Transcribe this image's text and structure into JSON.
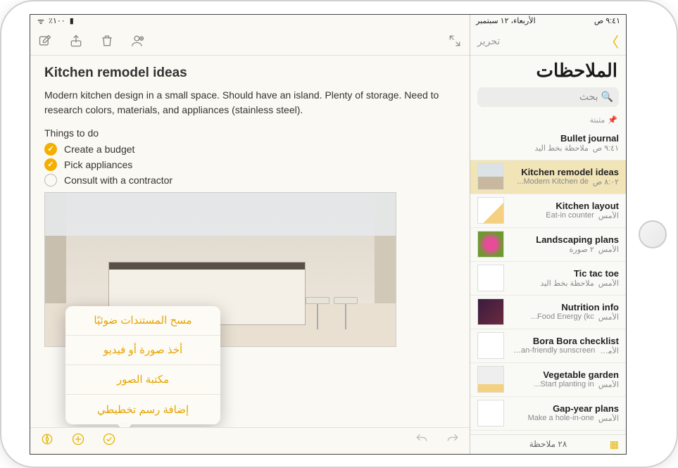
{
  "status": {
    "time": "٩:٤١ ص",
    "date": "الأربعاء، ١٢ سبتمبر",
    "battery_pct": "٪١٠٠"
  },
  "sidebar": {
    "edit_label": "تحرير",
    "title": "الملاحظات",
    "search_placeholder": "بحث",
    "pinned_label": "مثبتة",
    "footer_count": "٢٨ ملاحظة",
    "items": [
      {
        "title": "Bullet journal",
        "time": "٩:٤١ ص",
        "preview": "ملاحظة بخط اليد",
        "thumb": "none"
      },
      {
        "title": "Kitchen remodel ideas",
        "time": "٨:٠٢ ص",
        "preview": "Modern Kitchen de...",
        "thumb": "kitchen",
        "selected": true
      },
      {
        "title": "Kitchen layout",
        "time": "الأمس",
        "preview": "Eat-in counter",
        "thumb": "layout"
      },
      {
        "title": "Landscaping plans",
        "time": "الأمس",
        "preview": "٢ صورة",
        "thumb": "flower"
      },
      {
        "title": "Tic tac toe",
        "time": "الأمس",
        "preview": "ملاحظة بخط اليد",
        "thumb": "tic"
      },
      {
        "title": "Nutrition info",
        "time": "الأمس",
        "preview": "Food Energy (kc...",
        "thumb": "nutri"
      },
      {
        "title": "Bora Bora checklist",
        "time": "الأمس",
        "preview": "Ocean-friendly sunscreen",
        "thumb": "bora"
      },
      {
        "title": "Vegetable garden",
        "time": "الأمس",
        "preview": "Start planting in...",
        "thumb": "veg"
      },
      {
        "title": "Gap-year plans",
        "time": "الأمس",
        "preview": "Make a hole-in-one",
        "thumb": "gap"
      }
    ]
  },
  "note": {
    "title": "Kitchen remodel ideas",
    "body": "Modern kitchen design in a small space. Should have an island. Plenty of storage. Need to research colors, materials, and appliances (stainless steel).",
    "todo_header": "Things to do",
    "todos": [
      {
        "text": "Create a budget",
        "done": true
      },
      {
        "text": "Pick appliances",
        "done": true
      },
      {
        "text": "Consult with a contractor",
        "done": false
      }
    ]
  },
  "popover": {
    "items": [
      "مسح المستندات ضوئيًا",
      "أخذ صورة أو فيديو",
      "مكتبة الصور",
      "إضافة رسم تخطيطي"
    ]
  }
}
